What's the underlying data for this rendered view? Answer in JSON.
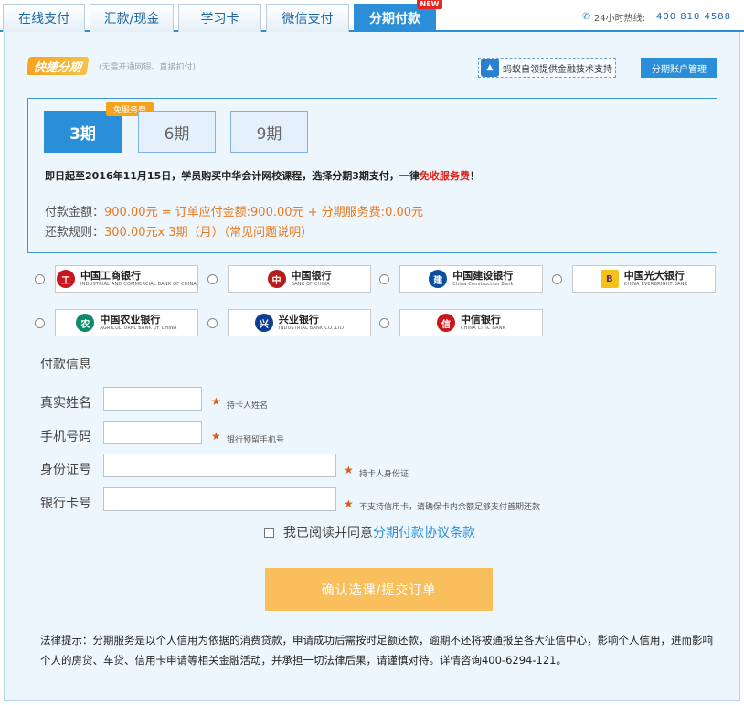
{
  "tabs": [
    {
      "label": "在线支付"
    },
    {
      "label": "汇款/现金"
    },
    {
      "label": "学习卡"
    },
    {
      "label": "微信支付"
    },
    {
      "label": "分期付款",
      "active": true
    }
  ],
  "new_badge": "NEW",
  "hotline": {
    "label": "24小时热线:",
    "number": "400 810 4588"
  },
  "logo": {
    "text": "快捷分期",
    "subtitle": "(无需开通网银、直接扣付)"
  },
  "ant_button": {
    "icon": "ant",
    "label": "蚂蚁自领提供金融技术支持"
  },
  "account_mgmt": "分期账户管理",
  "periods": [
    {
      "label": "3期",
      "active": true
    },
    {
      "label": "6期"
    },
    {
      "label": "9期"
    }
  ],
  "free_tag": "免服务费",
  "promo": {
    "text": "即日起至2016年11月15日，学员购买中华会计网校课程，选择分期3期支付，一律",
    "highlight": "免收服务费",
    "end": "！"
  },
  "payment": {
    "amount_label": "付款金额：",
    "amount_value": "900.00元 = 订单应付金额:900.00元 + 分期服务费:0.00元",
    "rule_label": "还款规则：",
    "rule_value": "300.00元x 3期（月）（常见问题说明）"
  },
  "banks": [
    {
      "name": "中国工商银行",
      "en": "INDUSTRIAL AND COMMERCIAL BANK OF CHINA",
      "icon": "icbc-logo",
      "color": "#c8161d",
      "glyph": "工"
    },
    {
      "name": "中国银行",
      "en": "BANK OF CHINA",
      "icon": "boc-logo",
      "color": "#b71c1c",
      "glyph": "中"
    },
    {
      "name": "中国建设银行",
      "en": "China Construction Bank",
      "icon": "ccb-logo",
      "color": "#0a4ea1",
      "glyph": "建"
    },
    {
      "name": "中国光大银行",
      "en": "CHINA EVERBRIGHT BANK",
      "icon": "ceb-logo",
      "color": "#f4c21a",
      "glyph": "B"
    },
    {
      "name": "中国农业银行",
      "en": "AGRICULTURAL BANK OF CHINA",
      "icon": "abc-logo",
      "color": "#0a8a6a",
      "glyph": "农"
    },
    {
      "name": "兴业银行",
      "en": "INDUSTRIAL BANK CO.,LTD",
      "icon": "cib-logo",
      "color": "#0b3d91",
      "glyph": "兴"
    },
    {
      "name": "中信银行",
      "en": "CHINA CITIC BANK",
      "icon": "citic-logo",
      "color": "#c8161d",
      "glyph": "信"
    }
  ],
  "form": {
    "title": "付款信息",
    "fields": [
      {
        "label": "真实姓名",
        "value": "",
        "hint": "持卡人姓名"
      },
      {
        "label": "手机号码",
        "value": "",
        "hint": "银行预留手机号"
      },
      {
        "label": "身份证号",
        "value": "",
        "hint": "持卡人身份证"
      },
      {
        "label": "银行卡号",
        "value": "",
        "hint": "不支持信用卡，请确保卡内余额足够支付首期还款"
      }
    ]
  },
  "agree": {
    "text": "我已阅读并同意",
    "link": "分期付款协议条款"
  },
  "submit": "确认选课/提交订单",
  "legal": "法律提示：分期服务是以个人信用为依据的消费贷款，申请成功后需按时足额还款，逾期不还将被通报至各大征信中心，影响个人信用，进而影响个人的房贷、车贷、信用卡申请等相关金融活动，并承担一切法律后果，请谨慎对待。详情咨询400-6294-121。"
}
